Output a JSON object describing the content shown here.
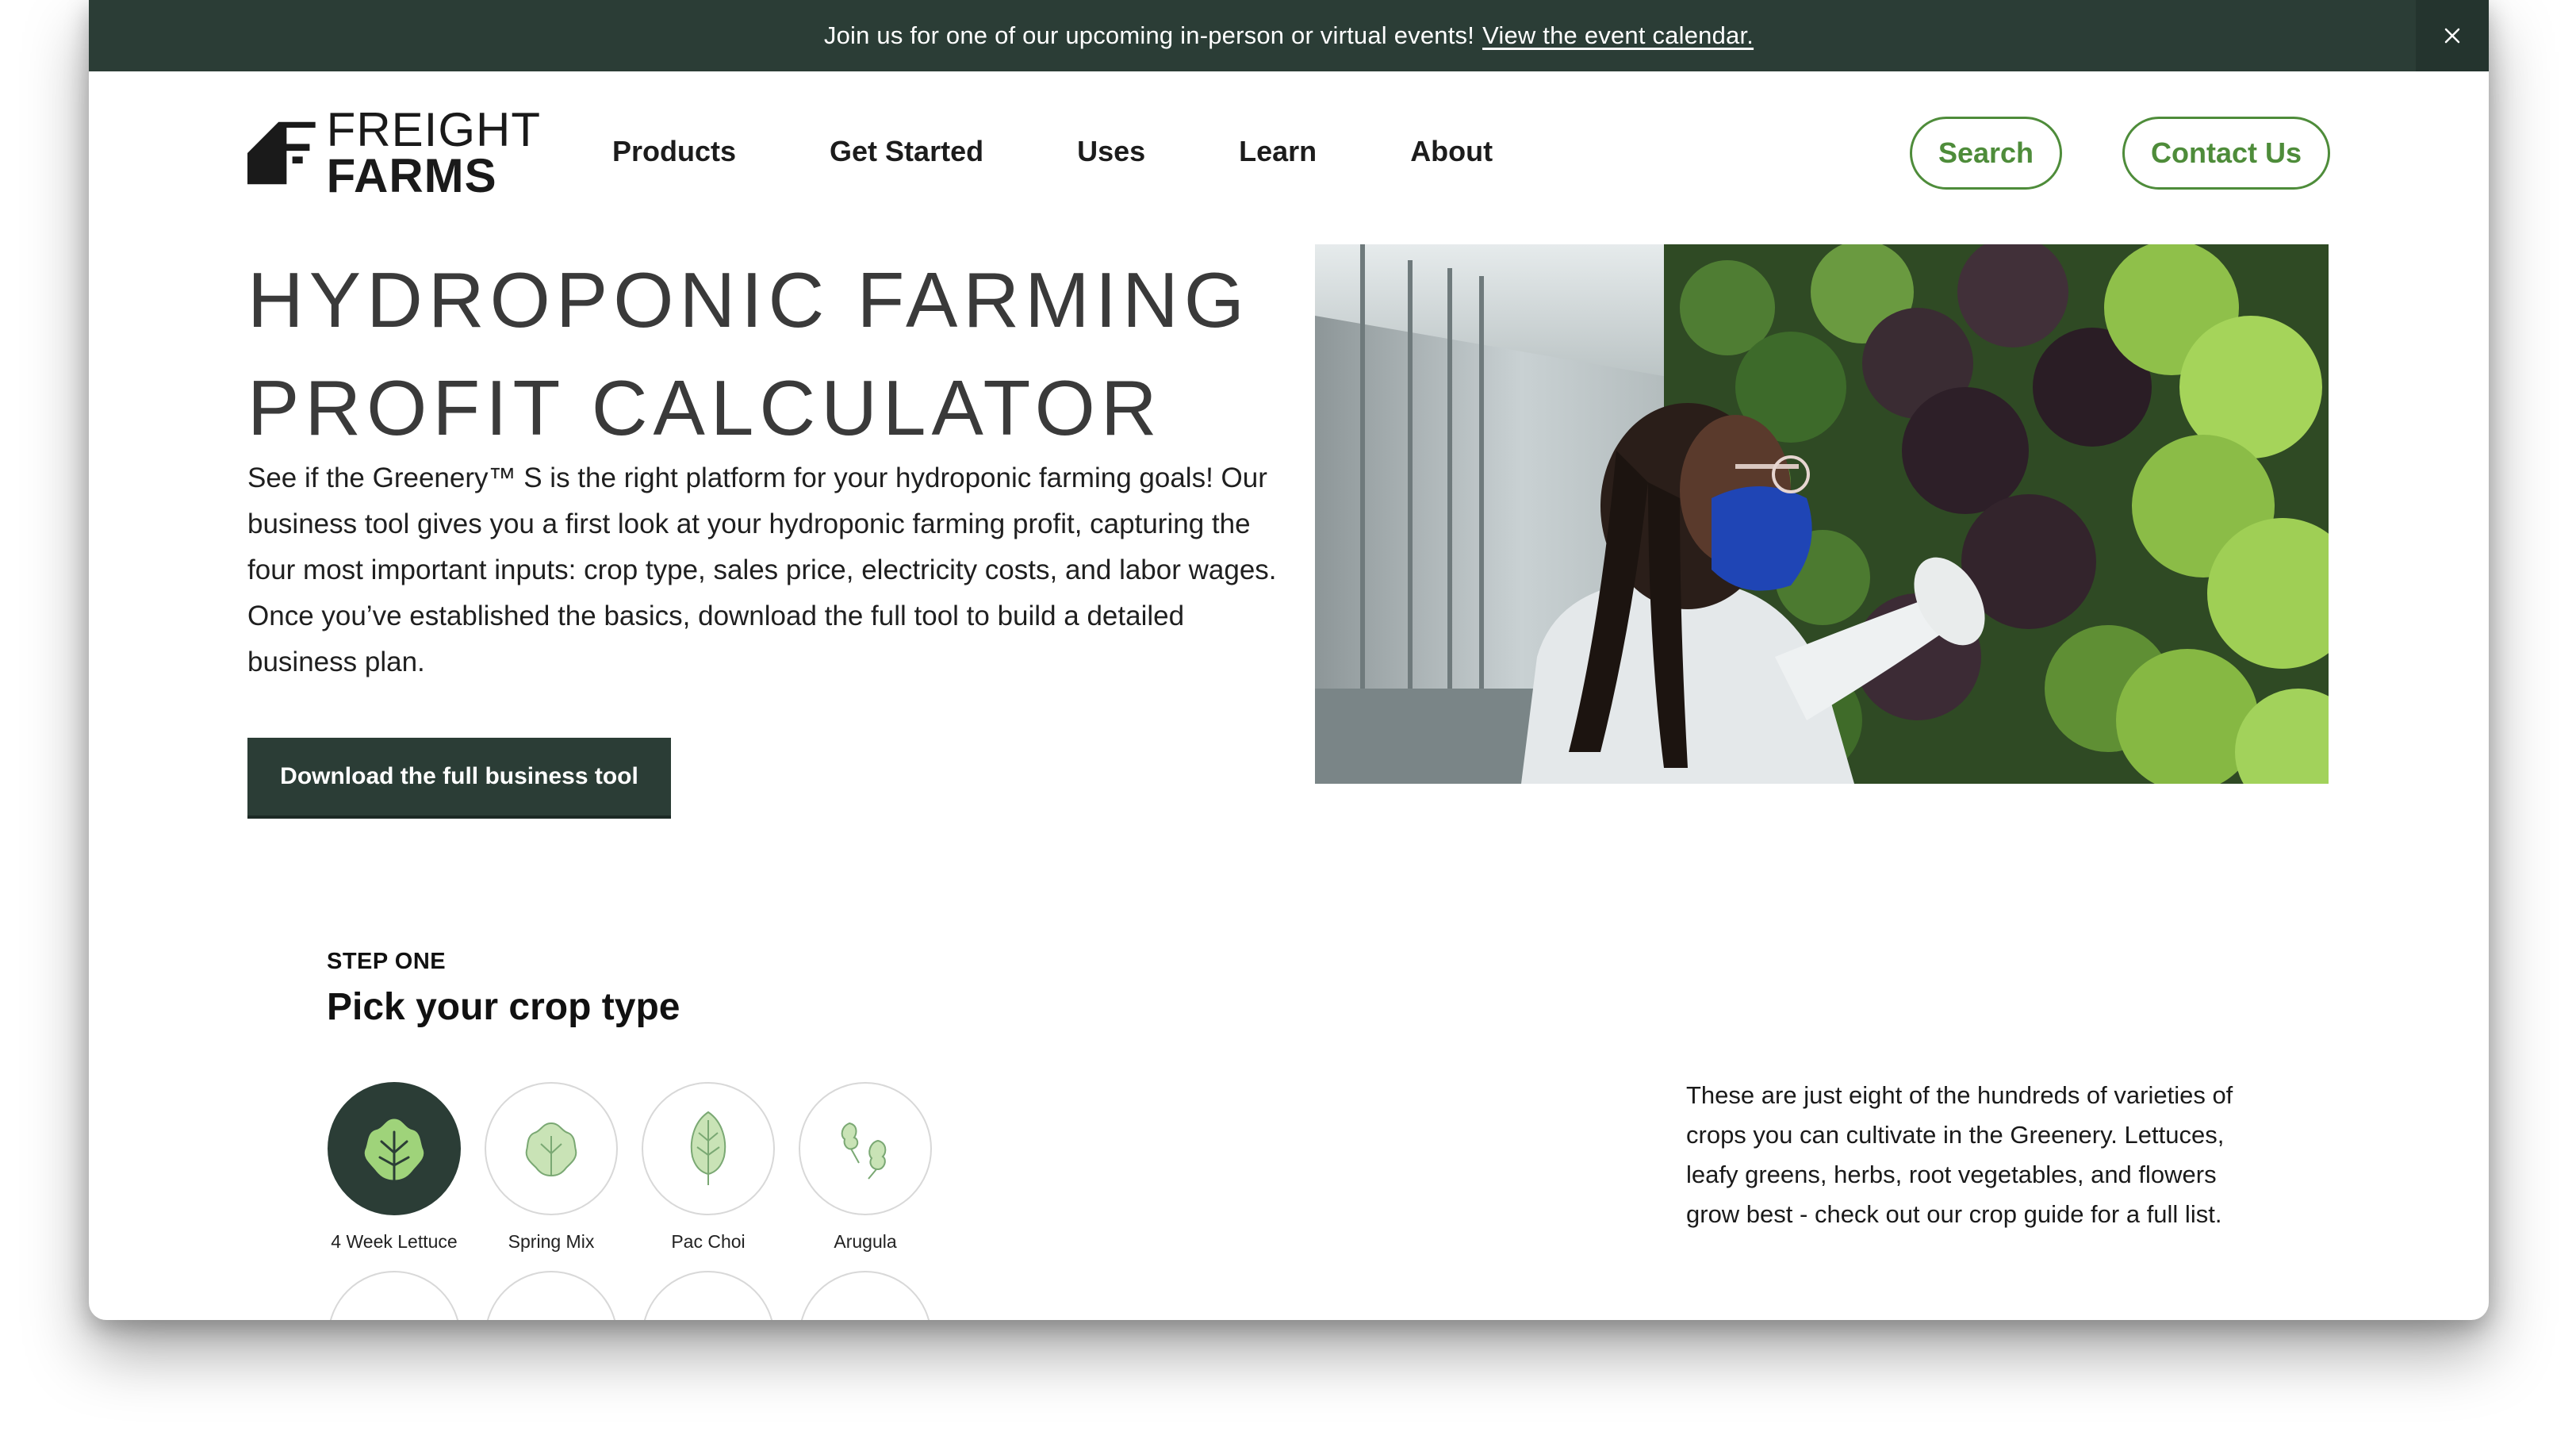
{
  "announcement": {
    "text": "Join us for one of our upcoming in-person or virtual events!",
    "link": "View the event calendar."
  },
  "logo": {
    "line1": "FREIGHT",
    "line2": "FARMS"
  },
  "nav": {
    "items": [
      "Products",
      "Get Started",
      "Uses",
      "Learn",
      "About"
    ]
  },
  "header_actions": {
    "search": "Search",
    "contact": "Contact Us"
  },
  "hero": {
    "title_line1": "HYDROPONIC FARMING",
    "title_line2": "PROFIT CALCULATOR",
    "description": "See if the Greenery™ S is the right platform for your hydroponic farming goals! Our business tool gives you a first look at your hydroponic farming profit, capturing the four most important inputs: crop type, sales price, electricity costs, and labor wages. Once you’ve established the basics, download the full tool to build a detailed business plan.",
    "download_button": "Download the full business tool"
  },
  "step": {
    "label": "STEP ONE",
    "title": "Pick your crop type",
    "crops": [
      {
        "label": "4 Week Lettuce",
        "icon": "lettuce-icon",
        "selected": true
      },
      {
        "label": "Spring Mix",
        "icon": "spring-mix-icon",
        "selected": false
      },
      {
        "label": "Pac Choi",
        "icon": "pac-choi-icon",
        "selected": false
      },
      {
        "label": "Arugula",
        "icon": "arugula-icon",
        "selected": false
      }
    ],
    "note": "These are just eight of the hundreds of varieties of crops you can cultivate in the Greenery. Lettuces, leafy greens, herbs, root vegetables, and flowers grow best - check out our crop guide for a full list."
  },
  "colors": {
    "dark_green": "#2b3d36",
    "accent_green": "#4e8c3a",
    "icon_light_green": "#c9e3b6"
  }
}
